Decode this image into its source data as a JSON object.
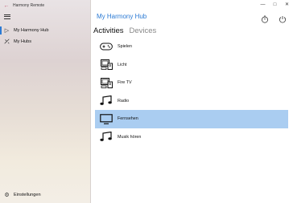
{
  "window": {
    "app_title": "Harmony Remote"
  },
  "sidebar": {
    "items": [
      {
        "label": "My Harmony Hub",
        "icon": "play-icon",
        "selected": true
      },
      {
        "label": "My Hubs",
        "icon": "hub-icon",
        "selected": false
      }
    ],
    "settings_label": "Einstellungen"
  },
  "main": {
    "hub_title": "My Harmony Hub",
    "tabs": [
      {
        "label": "Activities",
        "active": true
      },
      {
        "label": "Devices",
        "active": false
      }
    ],
    "activities": [
      {
        "label": "Spielen",
        "icon": "gamepad-icon",
        "selected": false
      },
      {
        "label": "Licht",
        "icon": "devices-icon",
        "selected": false
      },
      {
        "label": "Fire TV",
        "icon": "devices-icon",
        "selected": false
      },
      {
        "label": "Radio",
        "icon": "music-icon",
        "selected": false
      },
      {
        "label": "Fernsehen",
        "icon": "tv-icon",
        "selected": true
      },
      {
        "label": "Musik hören",
        "icon": "music-icon",
        "selected": false
      }
    ]
  },
  "colors": {
    "accent": "#2b7ad4",
    "selected_row": "#aacdf1",
    "back_arrow": "#c0506a"
  }
}
